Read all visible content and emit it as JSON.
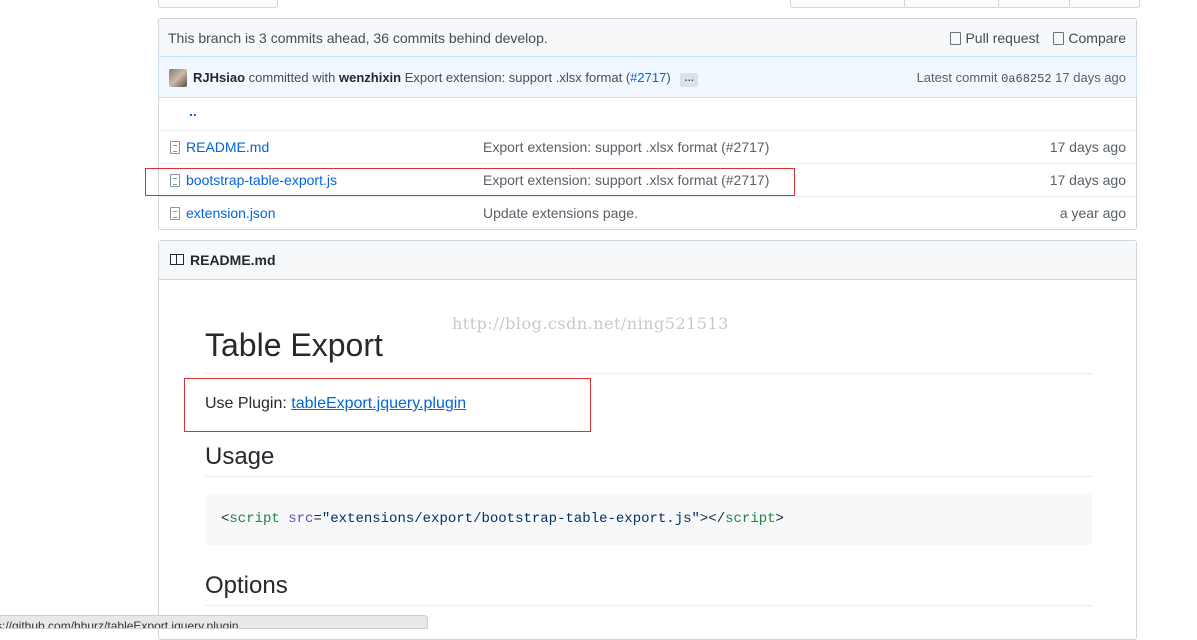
{
  "branch_bar": {
    "message": "This branch is 3 commits ahead, 36 commits behind develop.",
    "pull_request": "Pull request",
    "compare": "Compare"
  },
  "commit": {
    "author": "RJHsiao",
    "committed_with": "committed with",
    "committer": "wenzhixin",
    "message": "Export extension: support .xlsx format (",
    "pr_link": "#2717",
    "message_end": ")",
    "ellipsis": "…",
    "latest_label": "Latest commit",
    "sha": "0a68252",
    "age": "17 days ago"
  },
  "files": {
    "parent": "..",
    "rows": [
      {
        "name": "README.md",
        "message": "Export extension: support .xlsx format (#2717)",
        "age": "17 days ago"
      },
      {
        "name": "bootstrap-table-export.js",
        "message": "Export extension: support .xlsx format (#2717)",
        "age": "17 days ago"
      },
      {
        "name": "extension.json",
        "message": "Update extensions page.",
        "age": "a year ago"
      }
    ]
  },
  "readme": {
    "header": "README.md",
    "title": "Table Export",
    "plugin_label": "Use Plugin: ",
    "plugin_link": "tableExport.jquery.plugin",
    "usage": "Usage",
    "code": {
      "open_lt": "<",
      "tag": "script",
      "attr": " src",
      "eq": "=",
      "value": "\"extensions/export/bootstrap-table-export.js\"",
      "close": "></",
      "tag2": "script",
      "end": ">"
    },
    "options": "Options"
  },
  "watermark": "http://blog.csdn.net/ning521513",
  "status_bar": "s://github.com/hhurz/tableExport.jquery.plugin",
  "colors": {
    "link": "#0366d6",
    "highlight": "#d93131"
  }
}
